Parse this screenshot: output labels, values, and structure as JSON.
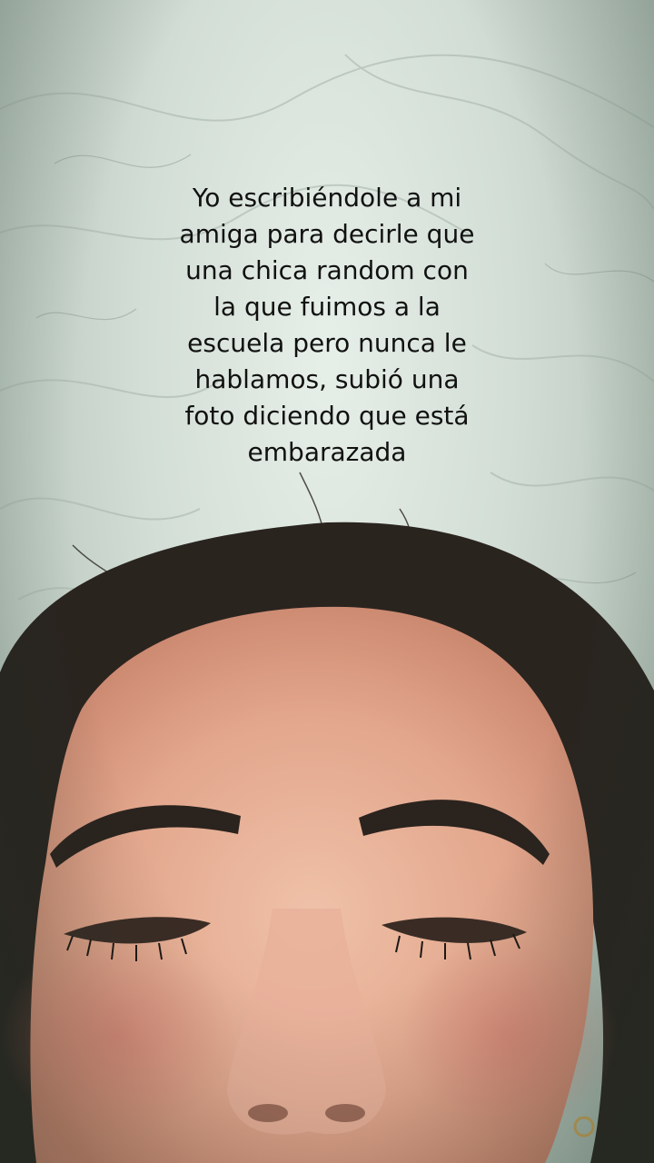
{
  "caption": {
    "lines": [
      "Yo escribiéndole a mi",
      "amiga para decirle que",
      "una chica random con",
      "la que fuimos a la",
      "escuela pero nunca le",
      "hablamos, subió una",
      "foto diciendo que está",
      "embarazada"
    ]
  },
  "colors": {
    "wall": "#d7e1d9",
    "hair": "#2a241f",
    "skin": "#e7b39a",
    "caption_text": "#111111"
  }
}
